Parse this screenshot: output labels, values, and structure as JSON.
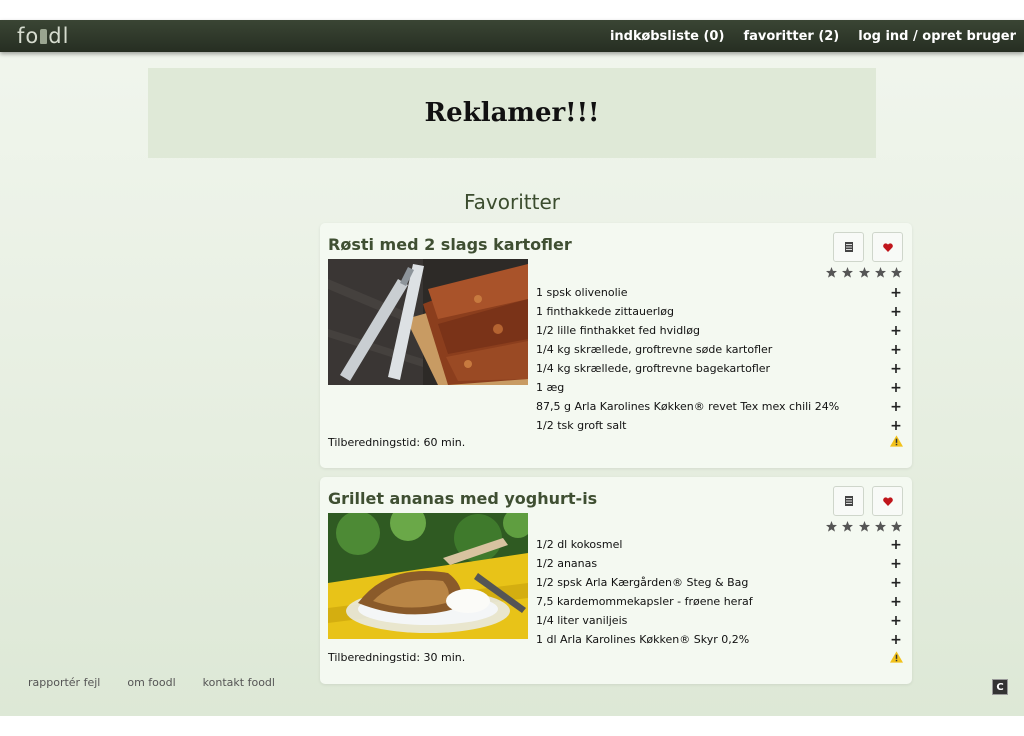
{
  "header": {
    "logo": "foodl",
    "nav": [
      "indkøbsliste (0)",
      "favoritter (2)",
      "log ind / opret bruger"
    ]
  },
  "ad": {
    "text": "Reklamer!!!"
  },
  "section_title": "Favoritter",
  "recipes": [
    {
      "title": "Røsti med 2 slags kartofler",
      "rating": 5,
      "ingredients": [
        "1 spsk olivenolie",
        "1 finthakkede zittauerløg",
        "1/2 lille finthakket fed hvidløg",
        "1/4 kg skrællede, groftrevne søde kartofler",
        "1/4 kg skrællede, groftrevne bagekartofler",
        "1 æg",
        "87,5 g Arla Karolines Køkken® revet Tex mex chili 24%",
        "1/2 tsk groft salt"
      ],
      "prep_time": "Tilberedningstid: 60 min."
    },
    {
      "title": "Grillet ananas med yoghurt-is",
      "rating": 5,
      "ingredients": [
        "1/2 dl kokosmel",
        "1/2 ananas",
        "1/2 spsk Arla Kærgården® Steg & Bag",
        "7,5 kardemommekapsler - frøene heraf",
        "1/4 liter vaniljeis",
        "1 dl Arla Karolines Køkken® Skyr 0,2%"
      ],
      "prep_time": "Tilberedningstid: 30 min."
    }
  ],
  "footer": {
    "links": [
      "rapportér fejl",
      "om foodl",
      "kontakt foodl"
    ],
    "corner_icon_glyph": "C"
  },
  "icons": {
    "list": "list-icon",
    "heart": "heart-icon",
    "star": "star-icon",
    "plus": "plus-icon",
    "warning": "warning-icon"
  },
  "colors": {
    "navbar": "#2e372a",
    "heart": "#c0151b",
    "warning": "#f2c21b",
    "title": "#3f4f32"
  }
}
